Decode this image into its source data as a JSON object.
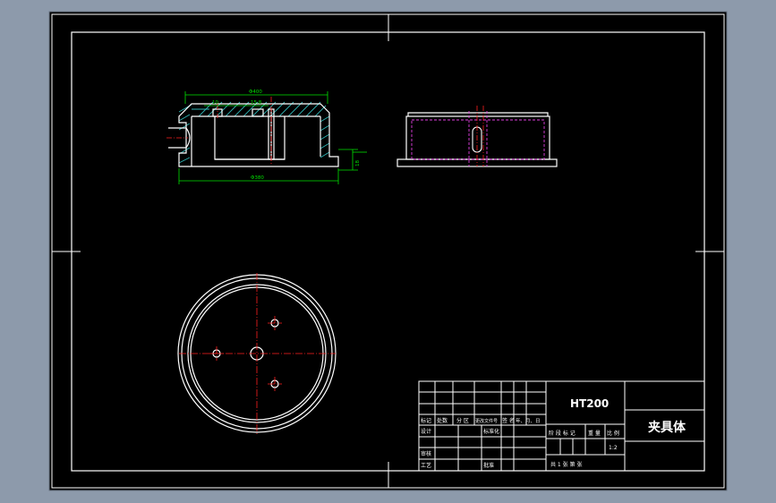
{
  "colors": {
    "background": "#8d9aab",
    "paper": "#000000",
    "line": "#ffffff",
    "hatch": "#2fb5b5",
    "dimension": "#00e000",
    "center": "#ff2020",
    "hidden": "#e040e0"
  },
  "drawing": {
    "part_name": "夹具体",
    "material": "HT200",
    "scale": "1:2",
    "sheet_text": "共 1 张  第  张"
  },
  "dimensions": {
    "top_width": "Φ400",
    "small_left": "10",
    "small_right": "15.8",
    "bottom_width": "Φ380",
    "height": "18"
  },
  "title_block": {
    "header_labels": [
      "标记",
      "处数",
      "分 区",
      "更改文件号",
      "签 名",
      "年、月、日"
    ],
    "design": "设计",
    "standardize": "标准化",
    "review": "审核",
    "process": "工艺",
    "approve": "批准",
    "stage_label": "阶 段 标 记",
    "weight_label": "重 量",
    "scale_label": "比 例"
  }
}
